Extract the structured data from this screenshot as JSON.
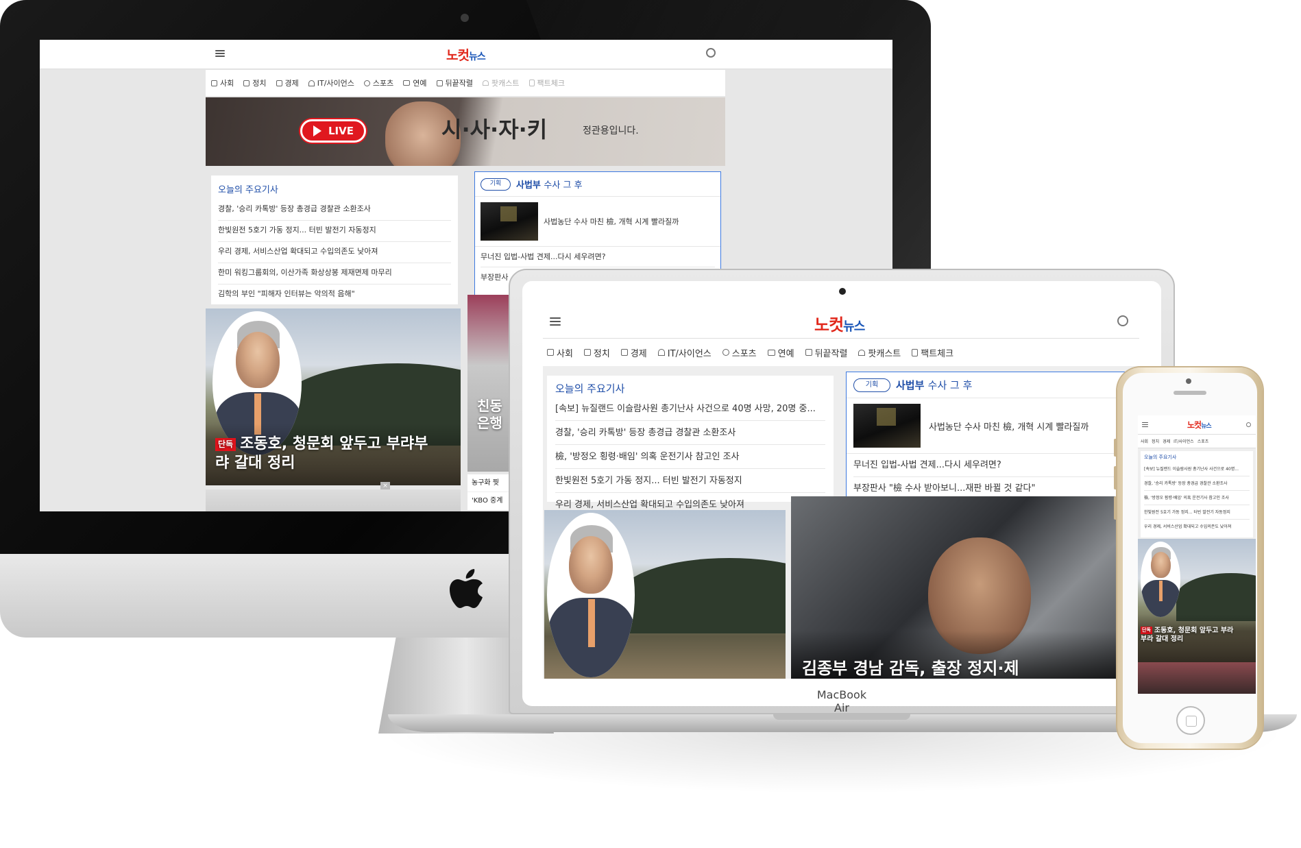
{
  "brand": {
    "logo_a": "노컷",
    "logo_b": "뉴스"
  },
  "colors": {
    "accent_red": "#e1281c",
    "accent_blue": "#1a56b8",
    "title_blue": "#1f4ea8",
    "tag_red": "#e0121b"
  },
  "nav_desktop": [
    "사회",
    "정치",
    "경제",
    "IT/사이언스",
    "스포츠",
    "연예",
    "뒤끝작렬",
    "팟캐스트",
    "팩트체크"
  ],
  "nav_tablet": [
    "사회",
    "정치",
    "경제",
    "IT/사이언스",
    "스포츠",
    "연예",
    "뒤끝작렬",
    "팟캐스트",
    "팩트체크"
  ],
  "banner": {
    "live": "LIVE",
    "title": "시·사·자·키",
    "sub": "정관용입니다."
  },
  "top_news": {
    "title": "오늘의 주요기사",
    "desktop_items": [
      "경찰, '승리 카톡방' 등장 총경급 경찰관 소환조사",
      "한빛원전 5호기 가동 정지... 터빈 발전기 자동정지",
      "우리 경제, 서비스산업 확대되고 수입의존도 낮아져",
      "한미 워킹그룹회의, 이산가족 화상상봉 제재면제 마무리",
      "김학의 부인 \"피해자 인터뷰는 악의적 음해\""
    ],
    "tablet_items": [
      "[속보] 뉴질랜드 이슬람사원 총기난사 사건으로 40명 사망, 20명 중...",
      "경찰, '승리 카톡방' 등장 총경급 경찰관 소환조사",
      "檢, '방정오 횡령·배임' 의혹 운전기사 참고인 조사",
      "한빛원전 5호기 가동 정지... 터빈 발전기 자동정지",
      "우리 경제, 서비스산업 확대되고 수입의존도 낮아져"
    ],
    "phone_items": [
      "[속보] 뉴질랜드 이슬람사원 총기난사 사건으로 40명...",
      "경찰, '승리 카톡방' 등장 총경급 경찰관 소환조사",
      "檢, '방정오 횡령·배임' 의혹 운전기사 참고인 조사",
      "한빛원전 5호기 가동 정지... 터빈 발전기 자동정지",
      "우리 경제, 서비스산업 확대되고 수입의존도 낮아져"
    ]
  },
  "series": {
    "badge": "기획",
    "title": "사법부",
    "title_sub": "수사 그 후",
    "thumb_headline": "사법농단 수사 마친 檢, 개혁 시계 빨라질까",
    "items": [
      "무너진 입법-사법 견제...다시 세우려면?",
      "부장판사 \"檢 수사 받아보니...재판 바뀔 것 같다\""
    ],
    "desktop_item2_short": "부장판사"
  },
  "feature": {
    "tag": "단독",
    "headline_l1": "조동호, 청문회 앞두고 부랴부",
    "headline_l2": "랴 갈대 정리",
    "phone_l1": "조동호, 청문회 앞두고 부라",
    "phone_l2": "부라 갈대 정리"
  },
  "desktop_side": {
    "headline_l1": "친동",
    "headline_l2": "은행",
    "rows": [
      "농구화 찢",
      "'KBO 중계"
    ]
  },
  "tablet_second": {
    "headline": "김종부 경남 감독, 출장 정지·제"
  },
  "device_label": "MacBook Air"
}
